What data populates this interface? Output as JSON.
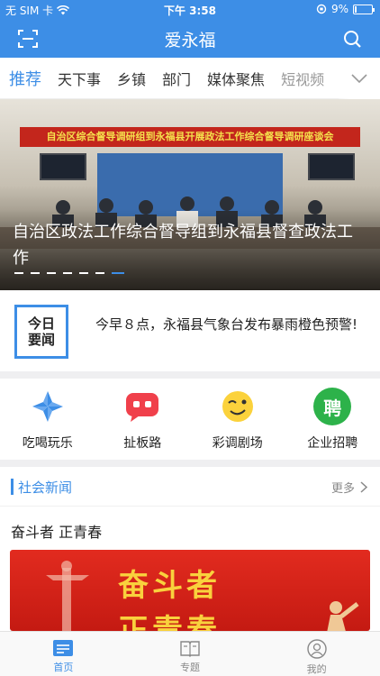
{
  "status_bar": {
    "carrier": "无 SIM 卡",
    "time": "下午 3:58",
    "battery": "9%",
    "battery_level": 0.09
  },
  "header": {
    "title": "爱永福",
    "scan_icon": "scan-icon",
    "search_icon": "search-icon"
  },
  "tabs": [
    {
      "label": "推荐",
      "active": true
    },
    {
      "label": "天下事"
    },
    {
      "label": "乡镇"
    },
    {
      "label": "部门"
    },
    {
      "label": "媒体聚焦"
    },
    {
      "label": "短视频"
    }
  ],
  "banner": {
    "sign_text": "自治区综合督导调研组到永福县开展政法工作综合督导调研座谈会",
    "title": "自治区政法工作综合督导组到永福县督查政法工作",
    "slide_count": 7,
    "active_slide": 6
  },
  "headline": {
    "logo_line1": "今日",
    "logo_line2": "要闻",
    "text": "今早８点，永福县气象台发布暴雨橙色预警!"
  },
  "shortcuts": [
    {
      "label": "吃喝玩乐",
      "icon": "pinwheel-icon"
    },
    {
      "label": "扯板路",
      "icon": "chat-bubble-icon"
    },
    {
      "label": "彩调剧场",
      "icon": "wink-face-icon"
    },
    {
      "label": "企业招聘",
      "icon": "recruit-icon",
      "icon_text": "聘"
    }
  ],
  "section": {
    "title": "社会新闻",
    "more": "更多"
  },
  "article": {
    "title": "奋斗者 正青春",
    "image_text_1": "奋斗者",
    "image_text_2": "正青春"
  },
  "bottom_nav": [
    {
      "label": "首页",
      "icon": "home-news-icon",
      "active": true
    },
    {
      "label": "专题",
      "icon": "book-icon"
    },
    {
      "label": "我的",
      "icon": "profile-icon"
    }
  ],
  "colors": {
    "accent": "#3d8ee6",
    "banner_sign": "#c3261c",
    "article_red": "#e22b1f",
    "gold": "#f9d13d"
  }
}
